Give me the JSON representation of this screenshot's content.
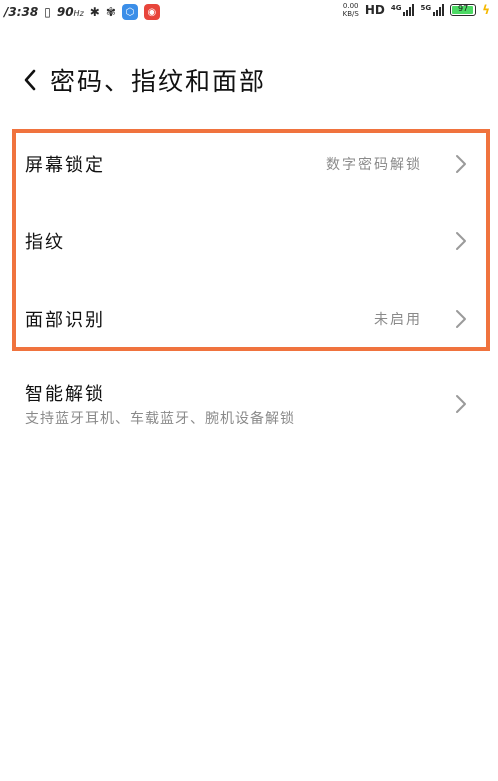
{
  "status_bar": {
    "time": "/3:38",
    "refresh_rate": "90",
    "refresh_unit": "Hz",
    "net_speed_value": "0.00",
    "net_speed_unit": "KB/S",
    "hd_label": "HD",
    "network_1": "4G",
    "network_2": "5G",
    "battery_level": "97",
    "battery_fraction": 0.97,
    "battery_color": "#4cd964"
  },
  "header": {
    "back_icon": "chevron-left-icon",
    "title": "密码、指纹和面部"
  },
  "highlight_color": "#f0733e",
  "settings": {
    "items": [
      {
        "label": "屏幕锁定",
        "value": "数字密码解锁"
      },
      {
        "label": "指纹",
        "value": ""
      },
      {
        "label": "面部识别",
        "value": "未启用"
      }
    ],
    "smart_unlock": {
      "label": "智能解锁",
      "description": "支持蓝牙耳机、车载蓝牙、腕机设备解锁"
    }
  }
}
